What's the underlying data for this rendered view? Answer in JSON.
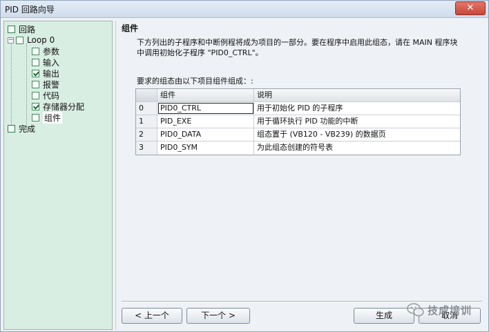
{
  "window": {
    "title": "PID 回路向导",
    "close_label": "✕"
  },
  "tree": {
    "root_label": "回路",
    "loop_label": "Loop 0",
    "items": [
      {
        "label": "参数",
        "checked": false
      },
      {
        "label": "输入",
        "checked": false
      },
      {
        "label": "输出",
        "checked": true
      },
      {
        "label": "报警",
        "checked": false
      },
      {
        "label": "代码",
        "checked": false
      },
      {
        "label": "存储器分配",
        "checked": true
      },
      {
        "label": "组件",
        "checked": false
      }
    ],
    "finish_label": "完成"
  },
  "content": {
    "heading": "组件",
    "description": "下方列出的子程序和中断例程将成为项目的一部分。要在程序中启用此组态，请在 MAIN 程序块中调用初始化子程序 \"PID0_CTRL\"。",
    "requirement": "要求的组态由以下项目组件组成：:",
    "table": {
      "headers": [
        "组件",
        "说明"
      ],
      "rows": [
        {
          "num": "0",
          "component": "PID0_CTRL",
          "desc": "用于初始化 PID 的子程序"
        },
        {
          "num": "1",
          "component": "PID_EXE",
          "desc": "用于循环执行 PID 功能的中断"
        },
        {
          "num": "2",
          "component": "PID0_DATA",
          "desc": "组态置于 (VB120 - VB239) 的数据页"
        },
        {
          "num": "3",
          "component": "PID0_SYM",
          "desc": "为此组态创建的符号表"
        }
      ]
    }
  },
  "buttons": {
    "prev": "< 上一个",
    "next": "下一个 >",
    "finish": "生成",
    "cancel": "取消"
  },
  "watermark": {
    "text": "技成培训"
  }
}
